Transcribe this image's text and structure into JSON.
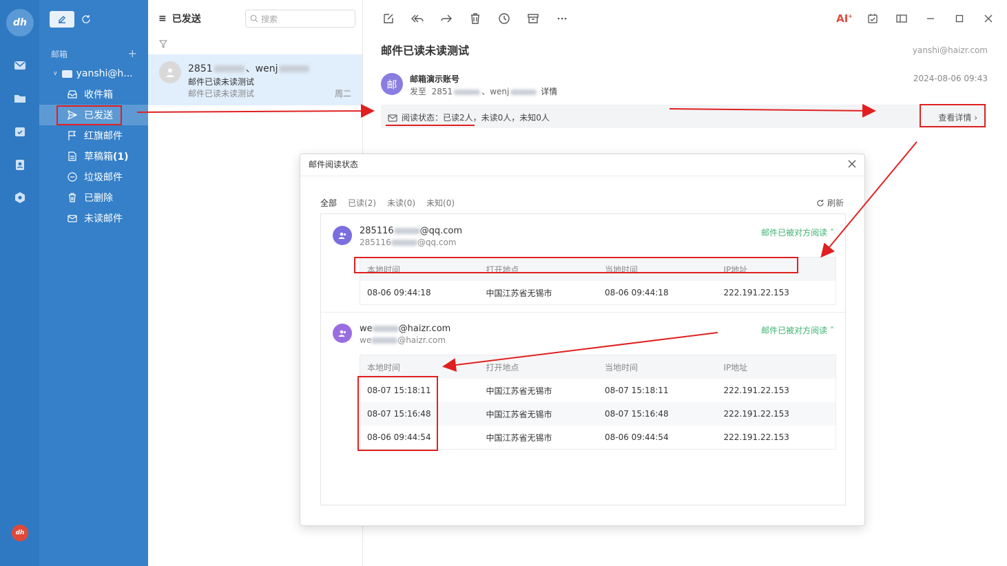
{
  "sidebar": {
    "section_label": "邮箱",
    "account": "yanshi@h...",
    "items": [
      {
        "label": "收件箱",
        "icon": "inbox-icon"
      },
      {
        "label": "已发送",
        "icon": "send-icon"
      },
      {
        "label": "红旗邮件",
        "icon": "flag-icon"
      },
      {
        "label": "草稿箱",
        "count": "(1)",
        "icon": "draft-icon"
      },
      {
        "label": "垃圾邮件",
        "icon": "spam-icon"
      },
      {
        "label": "已删除",
        "icon": "trash-icon"
      },
      {
        "label": "未读邮件",
        "icon": "unread-icon"
      }
    ]
  },
  "list": {
    "title": "已发送",
    "search_placeholder": "搜索",
    "message": {
      "from_prefix": "2851",
      "from_mid": "、wenj",
      "subject": "邮件已读未读测试",
      "preview": "邮件已读未读测试",
      "day": "周二"
    }
  },
  "pane": {
    "ai_label": "AI",
    "title": "邮件已读未读测试",
    "account": "yanshi@haizr.com",
    "sender_initial": "邮",
    "sender_name": "邮箱演示账号",
    "to_prefix": "发至",
    "to_a": "2851",
    "to_b": "、wenj",
    "to_detail": "详情",
    "date": "2024-08-06 09:43",
    "read_status": "阅读状态：已读2人，未读0人，未知0人",
    "view_detail": "查看详情 ›"
  },
  "modal": {
    "title": "邮件阅读状态",
    "tabs": [
      "全部",
      "已读(2)",
      "未读(0)",
      "未知(0)"
    ],
    "refresh": "刷新",
    "columns": [
      "本地时间",
      "打开地点",
      "当地时间",
      "IP地址"
    ],
    "readers": [
      {
        "email_prefix": "285116",
        "email_suffix": "@qq.com",
        "status": "邮件已被对方阅读 ˄",
        "rows": [
          [
            "08-06 09:44:18",
            "中国江苏省无锡市",
            "08-06 09:44:18",
            "222.191.22.153"
          ]
        ]
      },
      {
        "email_prefix": "we",
        "email_suffix": "@haizr.com",
        "status": "邮件已被对方阅读 ˄",
        "rows": [
          [
            "08-07 15:18:11",
            "中国江苏省无锡市",
            "08-07 15:18:11",
            "222.191.22.153"
          ],
          [
            "08-07 15:16:48",
            "中国江苏省无锡市",
            "08-07 15:16:48",
            "222.191.22.153"
          ],
          [
            "08-06 09:44:54",
            "中国江苏省无锡市",
            "08-06 09:44:54",
            "222.191.22.153"
          ]
        ]
      }
    ]
  },
  "colors": {
    "rail": "#2f79c2",
    "folders": "#3580c8",
    "accent_red": "#e02020",
    "read_green": "#3cb371"
  }
}
